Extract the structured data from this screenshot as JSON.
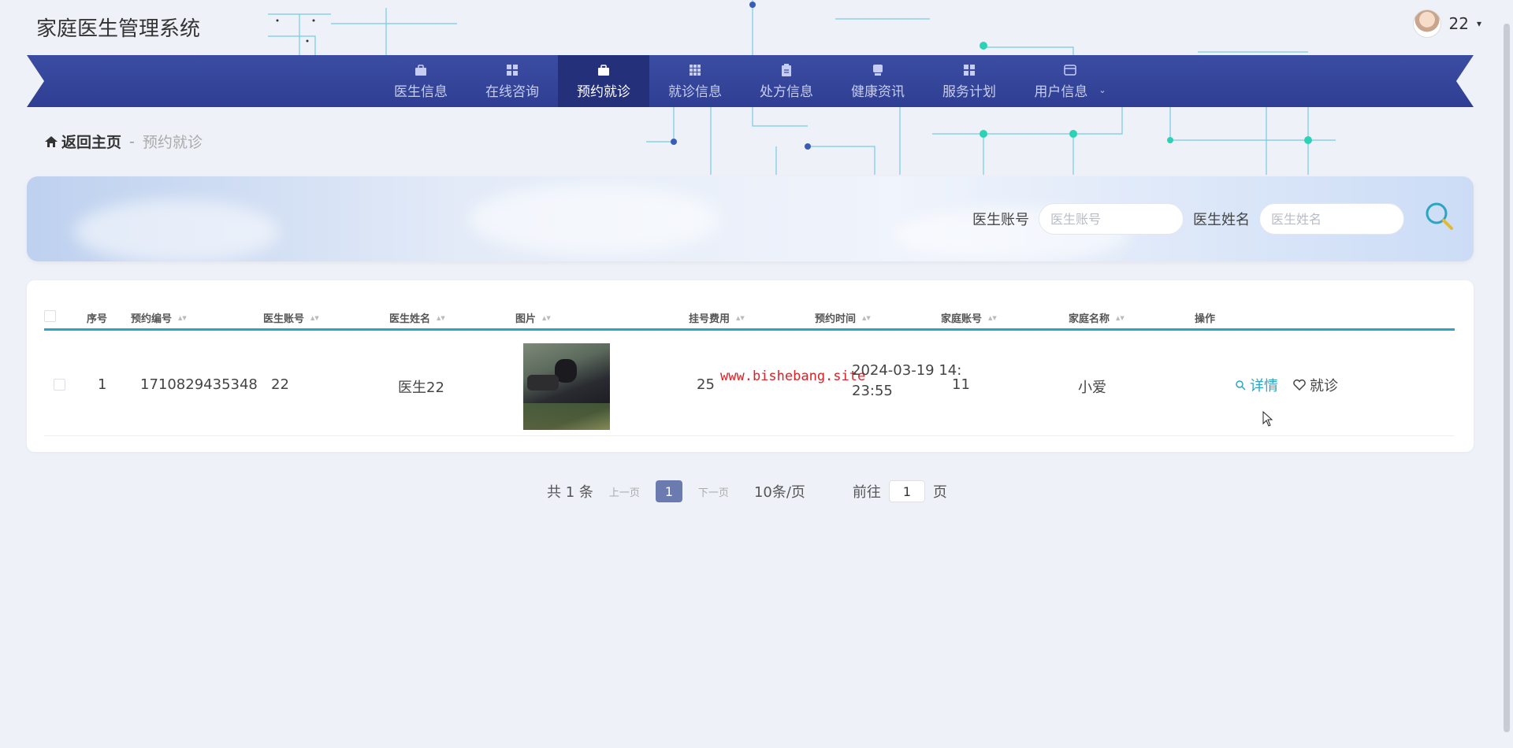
{
  "app": {
    "title": "家庭医生管理系统"
  },
  "user": {
    "name": "22",
    "caret": "▾"
  },
  "nav": {
    "items": [
      {
        "label": "医生信息",
        "icon": "briefcase-icon"
      },
      {
        "label": "在线咨询",
        "icon": "grid-icon"
      },
      {
        "label": "预约就诊",
        "icon": "briefcase-icon",
        "active": true
      },
      {
        "label": "就诊信息",
        "icon": "apps-icon"
      },
      {
        "label": "处方信息",
        "icon": "clipboard-icon"
      },
      {
        "label": "健康资讯",
        "icon": "news-icon"
      },
      {
        "label": "服务计划",
        "icon": "grid-icon"
      },
      {
        "label": "用户信息",
        "icon": "wallet-icon",
        "has_dropdown": true
      }
    ],
    "chevron": "⌄"
  },
  "breadcrumb": {
    "home": "返回主页",
    "separator": "-",
    "current": "预约就诊"
  },
  "search": {
    "doctor_account": {
      "label": "医生账号",
      "placeholder": "医生账号",
      "value": ""
    },
    "doctor_name": {
      "label": "医生姓名",
      "placeholder": "医生姓名",
      "value": ""
    }
  },
  "table": {
    "headers": {
      "index": "序号",
      "appointment_no": "预约编号",
      "doctor_account": "医生账号",
      "doctor_name": "医生姓名",
      "image": "图片",
      "fee": "挂号费用",
      "time": "预约时间",
      "family_account": "家庭账号",
      "family_name": "家庭名称",
      "actions": "操作"
    },
    "rows": [
      {
        "index": "1",
        "appointment_no": "1710829435348",
        "doctor_account": "22",
        "doctor_name": "医生22",
        "fee": "25",
        "time": "2024-03-19 14:23:55",
        "family_account": "11",
        "family_name": "小爱",
        "detail_label": "详情",
        "treat_label": "就诊"
      }
    ],
    "watermark": "www.bishebang.site"
  },
  "pagination": {
    "total_text": "共 1 条",
    "prev": "上一页",
    "current_page": "1",
    "next": "下一页",
    "page_size": "10条/页",
    "goto_prefix": "前往",
    "goto_value": "1",
    "goto_suffix": "页"
  },
  "colors": {
    "nav_bg": "#3b4da3",
    "nav_active": "#24307a",
    "accent": "#2aa6c4",
    "page_active": "#6b7bb0",
    "watermark": "#d8232a"
  }
}
